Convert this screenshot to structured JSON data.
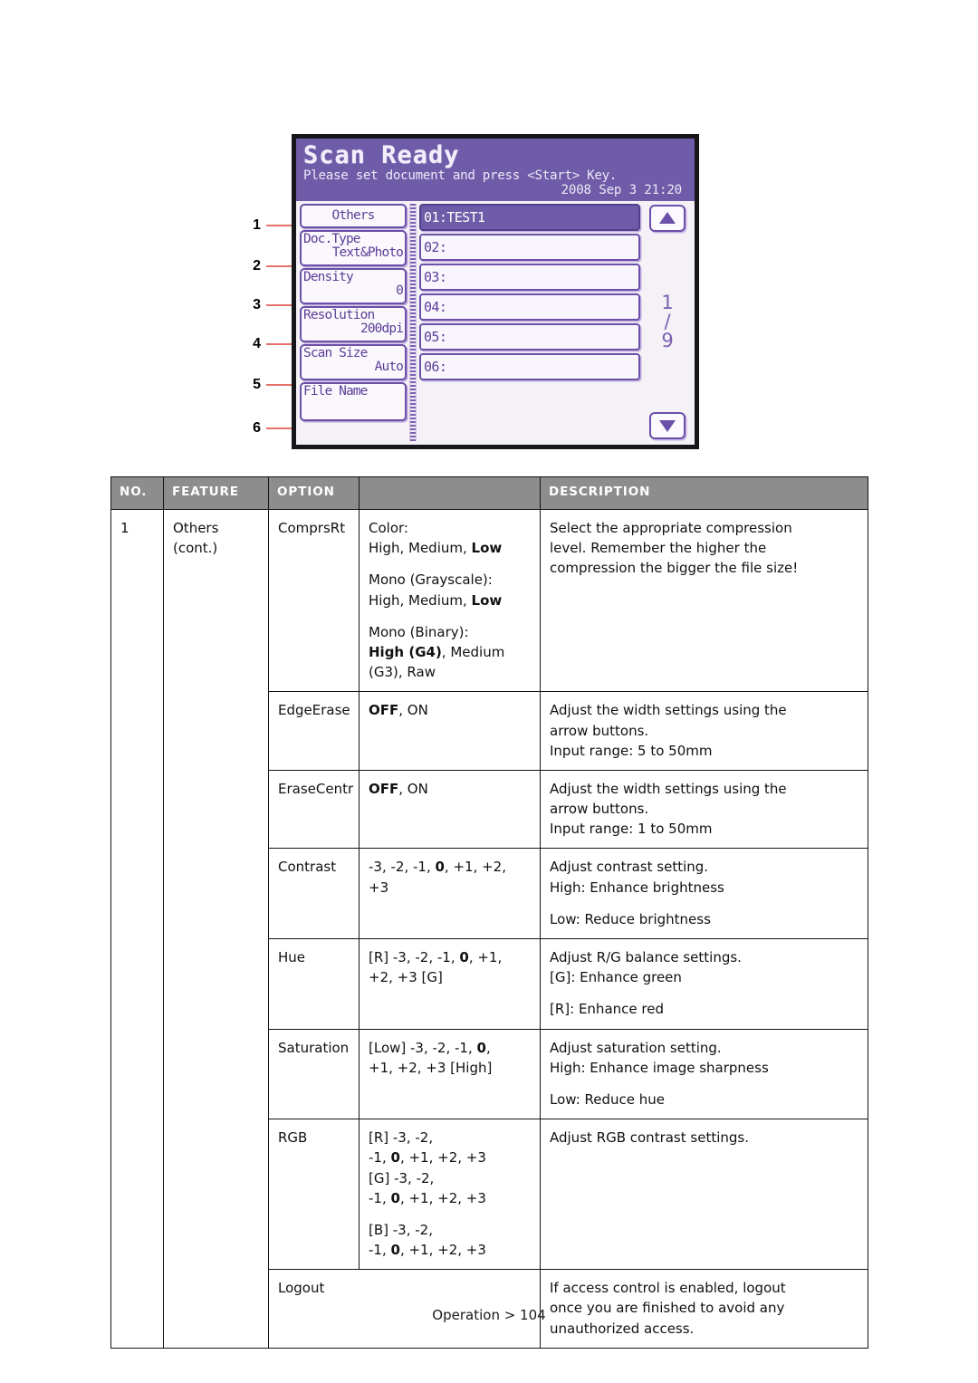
{
  "lcd": {
    "title": "Scan Ready",
    "subtitle": "Please set document and press <Start> Key.",
    "datetime": "2008 Sep  3 21:20",
    "left_buttons": [
      {
        "label": "Others",
        "value": ""
      },
      {
        "label": "Doc.Type",
        "value": "Text&Photo"
      },
      {
        "label": "Density",
        "value": "0"
      },
      {
        "label": "Resolution",
        "value": "200dpi"
      },
      {
        "label": "Scan Size",
        "value": "Auto"
      },
      {
        "label": "File Name",
        "value": ""
      }
    ],
    "list_items": [
      {
        "label": "01:TEST1",
        "selected": true
      },
      {
        "label": "02:",
        "selected": false
      },
      {
        "label": "03:",
        "selected": false
      },
      {
        "label": "04:",
        "selected": false
      },
      {
        "label": "05:",
        "selected": false
      },
      {
        "label": "06:",
        "selected": false
      }
    ],
    "scroll_up": "▲",
    "scroll_down": "▼",
    "page_current": "1",
    "page_separator": "/",
    "page_total": "9",
    "callouts": [
      "1",
      "2",
      "3",
      "4",
      "5",
      "6"
    ],
    "colors": {
      "lcd_purple": "#6e5ca8",
      "lcd_text_purple": "#5b3f97",
      "callout_red": "#e8716b"
    }
  },
  "table": {
    "headers": {
      "no": "NO.",
      "feature": "FEATURE",
      "option": "OPTION",
      "suboption": "",
      "description": "DESCRIPTION"
    },
    "row_no": "1",
    "feature_line1": "Others",
    "feature_line2": "(cont.)",
    "rows": [
      {
        "option": "ComprsRt",
        "sub_p1_a": "Color:",
        "sub_p1_b_plain": "High, Medium, ",
        "sub_p1_b_bold": "Low",
        "sub_p2_a": "Mono (Grayscale):",
        "sub_p2_b_plain": "High, Medium, ",
        "sub_p2_b_bold": "Low",
        "sub_p3_a": "Mono (Binary):",
        "sub_p3_b_bold": "High (G4)",
        "sub_p3_b_plain": ", Medium",
        "sub_p3_c": "(G3), Raw",
        "desc_1": "Select the appropriate compression",
        "desc_2": "level. Remember the higher the",
        "desc_3": "compression the bigger the file size!"
      },
      {
        "option": "EdgeErase",
        "sub_bold": "OFF",
        "sub_plain": ", ON",
        "desc_1": "Adjust the width settings using the",
        "desc_2": "arrow buttons.",
        "desc_3": "Input range: 5 to 50mm"
      },
      {
        "option": "EraseCentr",
        "sub_bold": "OFF",
        "sub_plain": ", ON",
        "desc_1": "Adjust the width settings using the",
        "desc_2": "arrow buttons.",
        "desc_3": "Input range: 1 to 50mm"
      },
      {
        "option": "Contrast",
        "sub_a": "-3, -2, -1, ",
        "sub_bold": "0",
        "sub_b": ", +1, +2,",
        "sub_c": "+3",
        "desc_1": "Adjust contrast setting.",
        "desc_2": "High: Enhance brightness",
        "desc_3": "Low: Reduce brightness"
      },
      {
        "option": "Hue",
        "sub_a": "[R] -3, -2, -1, ",
        "sub_bold": "0",
        "sub_b": ", +1,",
        "sub_c": "+2, +3 [G]",
        "desc_1": "Adjust R/G balance settings.",
        "desc_2": "[G]: Enhance green",
        "desc_3": "[R]: Enhance red"
      },
      {
        "option": "Saturation",
        "sub_a": "[Low] -3, -2, -1, ",
        "sub_bold": "0",
        "sub_b": ",",
        "sub_c": "+1, +2, +3 [High]",
        "desc_1": "Adjust saturation setting.",
        "desc_2": "High: Enhance image sharpness",
        "desc_3": "Low: Reduce hue"
      },
      {
        "option": "RGB",
        "sub_r_1": "[R] -3, -2,",
        "sub_r_2a": "-1, ",
        "sub_r_2b": "0",
        "sub_r_2c": ", +1, +2, +3",
        "sub_g_1": "[G] -3, -2,",
        "sub_g_2a": "-1, ",
        "sub_g_2b": "0",
        "sub_g_2c": ", +1, +2, +3",
        "sub_b_1": "[B] -3, -2,",
        "sub_b_2a": "-1, ",
        "sub_b_2b": "0",
        "sub_b_2c": ", +1, +2, +3",
        "desc_1": "Adjust RGB contrast settings."
      },
      {
        "option": "Logout",
        "desc_1": "If access control is enabled, logout",
        "desc_2": "once you are finished to avoid any",
        "desc_3": "unauthorized access."
      }
    ]
  },
  "footer": {
    "text": "Operation > 104"
  }
}
